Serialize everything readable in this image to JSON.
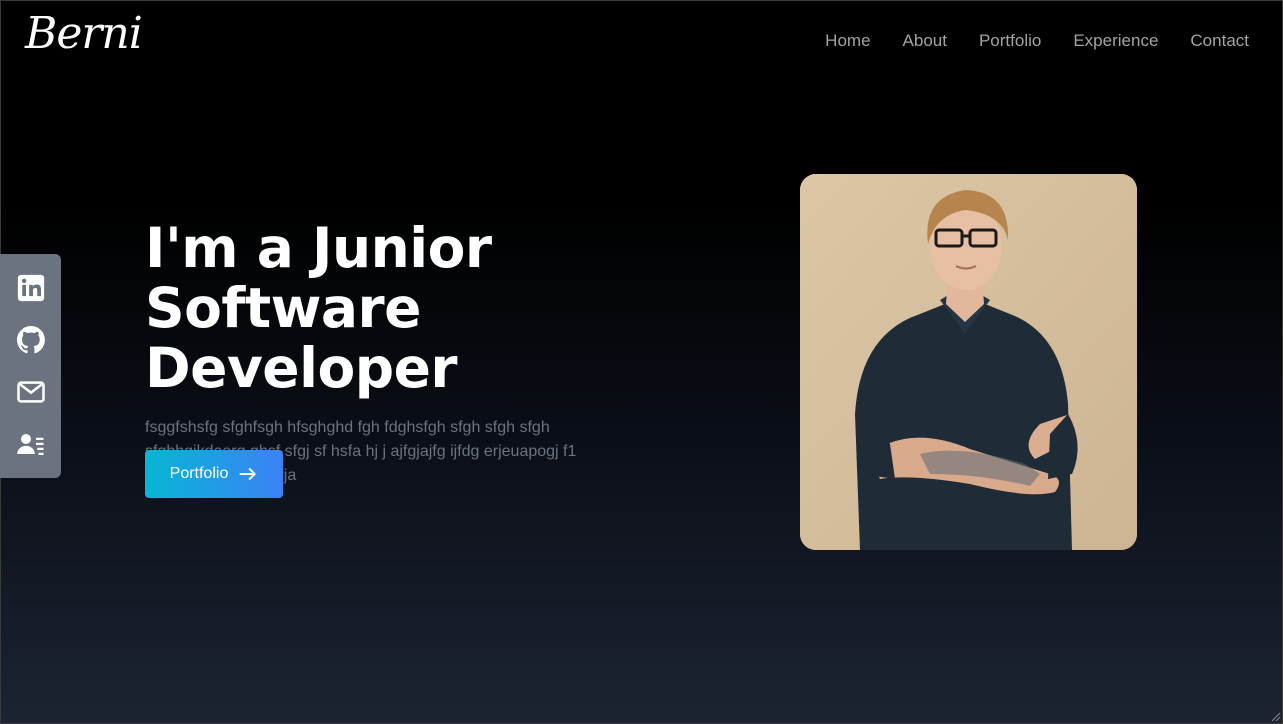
{
  "nav": {
    "logo": "Berni",
    "links": [
      "Home",
      "About",
      "Portfolio",
      "Experience",
      "Contact"
    ]
  },
  "social": {
    "items": [
      {
        "icon": "linkedin-icon"
      },
      {
        "icon": "github-icon"
      },
      {
        "icon": "mail-icon"
      },
      {
        "icon": "contact-card-icon"
      }
    ]
  },
  "hero": {
    "title_line1": "I'm a Junior Software",
    "title_line2": "Developer",
    "description": "fsggfshsfg sfghfsgh hfsghghd fgh fdghsfgh sfgh sfgh sfgh sfghhgjkdaerg ghsf sfgj sf hsfa hj j ajfgjajfg ijfdg erjeuapogj f1 rgdoie tq3ut o9 3terja",
    "button_label": "Portfolio",
    "button_icon": "arrow-right-icon"
  },
  "colors": {
    "accent_start": "#06b6d4",
    "accent_end": "#3b82f6",
    "sidebar": "#6b7280",
    "nav_text": "#a3a3a3"
  }
}
